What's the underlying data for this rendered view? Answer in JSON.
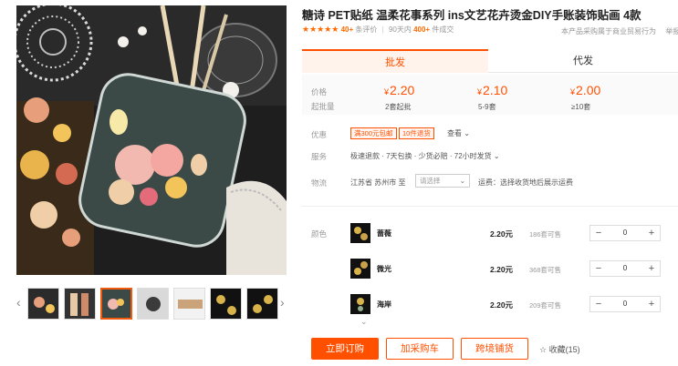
{
  "product": {
    "title": "糖诗 PET贴纸 温柔花事系列 ins文艺花卉烫金DIY手账装饰贴画 4款",
    "stars": "★★★★★",
    "reviews_count": "40+",
    "reviews_label": "条评价",
    "period": "90天内",
    "sold_count": "400+",
    "sold_label": "件成交",
    "top_right": "本产品采购属于商业贸易行为",
    "top_right_extra": "举报"
  },
  "tabs": {
    "wholesale": "批发",
    "dropship": "代发"
  },
  "pricing": {
    "price_label": "价格",
    "qty_label": "起批量",
    "tiers": [
      {
        "currency": "¥",
        "price": "2.20",
        "qty": "2套起批"
      },
      {
        "currency": "¥",
        "price": "2.10",
        "qty": "5-9套"
      },
      {
        "currency": "¥",
        "price": "2.00",
        "qty": "≥10套"
      }
    ]
  },
  "promo": {
    "label": "优惠",
    "tag1": "满300元包邮",
    "tag2": "10件退货",
    "dropdown": "查看"
  },
  "service": {
    "label": "服务",
    "text": "极速退款 · 7天包换 · 少货必赔 · 72小时发货"
  },
  "shipping": {
    "label": "物流",
    "from": "江苏省 苏州市",
    "to_label": "至",
    "select_placeholder": "请选择",
    "fee_text": "运费：选择收货地后展示运费"
  },
  "sku": {
    "label": "颜色",
    "items": [
      {
        "name": "蔷薇",
        "price": "2.20元",
        "stock": "186套可售",
        "qty": "0"
      },
      {
        "name": "微光",
        "price": "2.20元",
        "stock": "368套可售",
        "qty": "0"
      },
      {
        "name": "海岸",
        "price": "2.20元",
        "stock": "209套可售",
        "qty": "0"
      }
    ]
  },
  "actions": {
    "buy": "立即订购",
    "cart": "加采购车",
    "cross": "跨境铺货",
    "fav": "收藏(15)"
  },
  "icons": {
    "star": "star-icon",
    "fav": "star-outline-icon",
    "chevron": "chevron-down-icon"
  },
  "colors": {
    "accent": "#ff5000",
    "star": "#ff6a00"
  }
}
